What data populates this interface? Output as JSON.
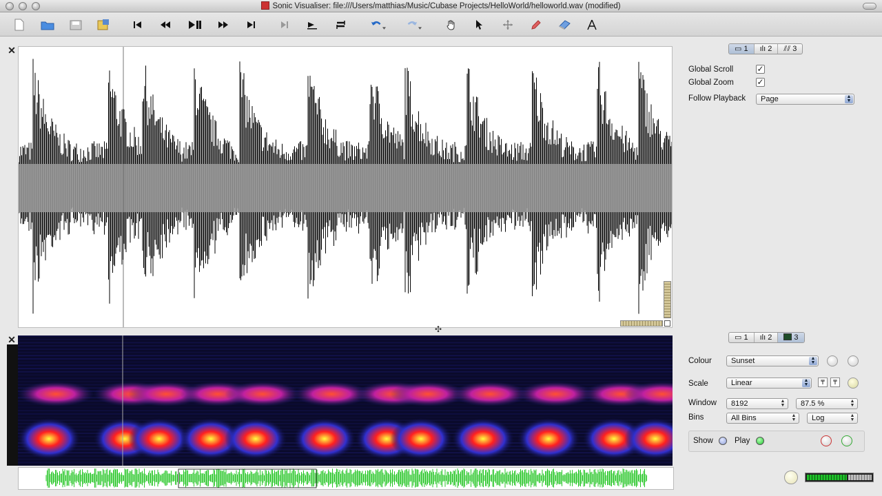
{
  "window": {
    "title": "Sonic Visualiser: file:///Users/matthias/Music/Cubase Projects/HelloWorld/helloworld.wav (modified)"
  },
  "toolbar": {
    "icons": [
      "new-document-icon",
      "open-folder-icon",
      "save-icon",
      "export-icon",
      "rewind-start-icon",
      "rewind-icon",
      "play-pause-icon",
      "fast-forward-icon",
      "fast-forward-end-icon",
      "step-icon",
      "play-selection-icon",
      "loop-icon",
      "undo-icon",
      "redo-icon",
      "navigate-hand-icon",
      "select-arrow-icon",
      "move-icon",
      "draw-pencil-icon",
      "erase-icon",
      "measure-icon"
    ]
  },
  "top_panel": {
    "tabs": [
      {
        "label": "1",
        "icon": "ruler-icon",
        "selected": true
      },
      {
        "label": "2",
        "icon": "bars-icon",
        "selected": false
      },
      {
        "label": "3",
        "icon": "waveform-icon",
        "selected": false
      }
    ],
    "global_scroll_label": "Global Scroll",
    "global_scroll_checked": true,
    "global_zoom_label": "Global Zoom",
    "global_zoom_checked": true,
    "follow_playback_label": "Follow Playback",
    "follow_playback_value": "Page"
  },
  "bottom_panel": {
    "tabs": [
      {
        "label": "1",
        "icon": "ruler-icon",
        "selected": false
      },
      {
        "label": "2",
        "icon": "bars-icon",
        "selected": false
      },
      {
        "label": "3",
        "icon": "spectrogram-icon",
        "selected": true
      }
    ],
    "colour_label": "Colour",
    "colour_value": "Sunset",
    "scale_label": "Scale",
    "scale_value": "Linear",
    "window_label": "Window",
    "window_value": "8192",
    "overlap_value": "87.5 %",
    "bins_label": "Bins",
    "bins_value": "All Bins",
    "freq_scale_value": "Log",
    "show_label": "Show",
    "play_label": "Play",
    "colors": {
      "show_led": "#8fa0d8",
      "play_led": "#22c433"
    }
  },
  "colors": {
    "waveform_fill": "#000000",
    "waveform_mid": "#9a9a9a",
    "spectrogram_bg": "#0a0a2a",
    "overview_wave": "#22c422"
  }
}
